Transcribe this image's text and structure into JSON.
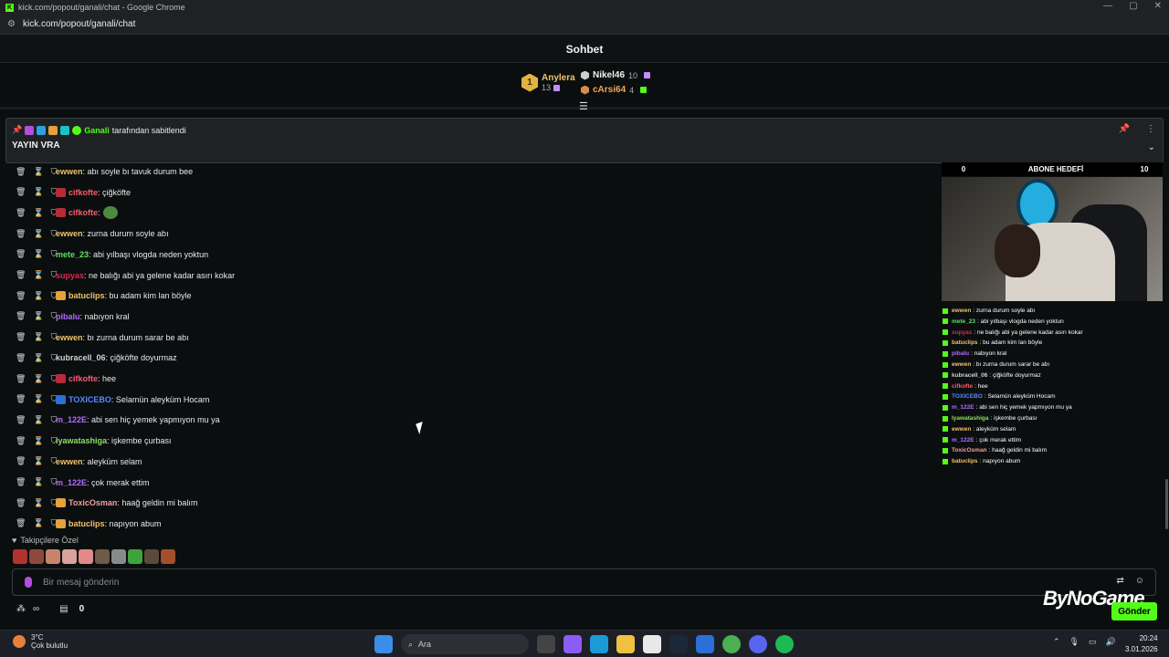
{
  "window": {
    "title": "kick.com/popout/ganali/chat - Google Chrome",
    "url": "kick.com/popout/ganali/chat"
  },
  "header": {
    "title": "Sohbet"
  },
  "leaderboard": {
    "first": {
      "rank": "1",
      "name": "Anylera",
      "count": "13"
    },
    "others": [
      {
        "name": "Nikel46",
        "count": "10"
      },
      {
        "name": "cArsi64",
        "count": "4"
      }
    ]
  },
  "pinned": {
    "pinned_by_name": "Ganali",
    "pinned_by_text": "tarafından sabitlendi",
    "message": "YAYIN VRA"
  },
  "messages": [
    {
      "user": "ewwen",
      "color": "#f0c36a",
      "text": ": abı soyle bı tavuk durum bee",
      "badge": ""
    },
    {
      "user": "cifkofte",
      "color": "#ff5a6e",
      "text": ": çiğköfte",
      "badge": "red"
    },
    {
      "user": "cifkofte",
      "color": "#ff5a6e",
      "text": ":",
      "badge": "red",
      "emote": true
    },
    {
      "user": "ewwen",
      "color": "#f0c36a",
      "text": ": zurna durum soyle abı",
      "badge": ""
    },
    {
      "user": "mete_23",
      "color": "#5ee35e",
      "text": ": abi yılbaşı vlogda neden yoktun",
      "badge": ""
    },
    {
      "user": "supyas",
      "color": "#e0264f",
      "text": ": ne balığı abi ya gelene kadar asırı kokar",
      "badge": ""
    },
    {
      "user": "batuclips",
      "color": "#f0c36a",
      "text": ": bu adam kim lan böyle",
      "badge": "crown"
    },
    {
      "user": "pibalu",
      "color": "#b06cff",
      "text": ": nabıyon kral",
      "badge": ""
    },
    {
      "user": "ewwen",
      "color": "#f0c36a",
      "text": ": bı zurna durum sarar be abı",
      "badge": ""
    },
    {
      "user": "kubracell_06",
      "color": "#d0d0d0",
      "text": ": çiğköfte doyurmaz",
      "badge": ""
    },
    {
      "user": "cifkofte",
      "color": "#ff5a6e",
      "text": ": hee",
      "badge": "red"
    },
    {
      "user": "TOXICEBO",
      "color": "#4f8cff",
      "text": ": Selamün aleyküm Hocam",
      "badge": "blue"
    },
    {
      "user": "m_122E",
      "color": "#b06cff",
      "text": ": abi sen hiç yemek yapmıyon mu ya",
      "badge": ""
    },
    {
      "user": "Iyawatashiga",
      "color": "#8fe067",
      "text": ": işkembe çurbası",
      "badge": ""
    },
    {
      "user": "ewwen",
      "color": "#f0c36a",
      "text": ": aleyküm selam",
      "badge": ""
    },
    {
      "user": "m_122E",
      "color": "#b06cff",
      "text": ": çok merak ettim",
      "badge": ""
    },
    {
      "user": "ToxicOsman",
      "color": "#f0a0a0",
      "text": ": haağ geldin mi balım",
      "badge": "gold"
    },
    {
      "user": "batuclips",
      "color": "#f0c36a",
      "text": ": napıyon abum",
      "badge": "crown"
    }
  ],
  "overlay": {
    "goal_left": "0",
    "goal_title": "ABONE HEDEFİ",
    "goal_right": "10",
    "mini_chat": [
      {
        "user": "ewwen",
        "color": "#f0c36a",
        "text": ": zurna durum soyle abı"
      },
      {
        "user": "mete_23",
        "color": "#5ee35e",
        "text": ": abi yılbaşı vlogda neden yoktun"
      },
      {
        "user": "supyas",
        "color": "#e0264f",
        "text": ": ne balığı abi ya gelene kadar asırı kokar"
      },
      {
        "user": "batuclips",
        "color": "#f0c36a",
        "text": ": bu adam kim lan böyle"
      },
      {
        "user": "pibalu",
        "color": "#b06cff",
        "text": ": nabıyon kral"
      },
      {
        "user": "ewwen",
        "color": "#f0c36a",
        "text": ": bı zurna durum sarar be abı"
      },
      {
        "user": "kubracell_06",
        "color": "#d0d0d0",
        "text": ": çiğköfte doyurmaz"
      },
      {
        "user": "cifkofte",
        "color": "#ff5a6e",
        "text": ": hee"
      },
      {
        "user": "TOXICEBO",
        "color": "#4f8cff",
        "text": ": Selamün aleyküm Hocam"
      },
      {
        "user": "m_122E",
        "color": "#b06cff",
        "text": ": abi sen hiç yemek yapmıyon mu ya"
      },
      {
        "user": "Iyawatashiga",
        "color": "#8fe067",
        "text": ": işkembe çurbası"
      },
      {
        "user": "ewwen",
        "color": "#f0c36a",
        "text": ": aleyküm selam"
      },
      {
        "user": "m_122E",
        "color": "#b06cff",
        "text": ": çok merak ettim"
      },
      {
        "user": "ToxicOsman",
        "color": "#f0a0a0",
        "text": ": haağ geldin mi balım"
      },
      {
        "user": "batuclips",
        "color": "#f0c36a",
        "text": ": napıyon abum"
      }
    ]
  },
  "followers_label": "Takipçilere Özel",
  "input": {
    "placeholder": "Bir mesaj gönderin"
  },
  "bottom": {
    "count": "0"
  },
  "watermark": "ByNoGame",
  "send_label": "Gönder",
  "taskbar": {
    "temp": "3°C",
    "weather": "Çok bulutlu",
    "search": "Ara",
    "time": "20:24",
    "date": "3.01.2026"
  },
  "colors": {
    "accent": "#53fc18",
    "background": "#0b0e0f"
  }
}
